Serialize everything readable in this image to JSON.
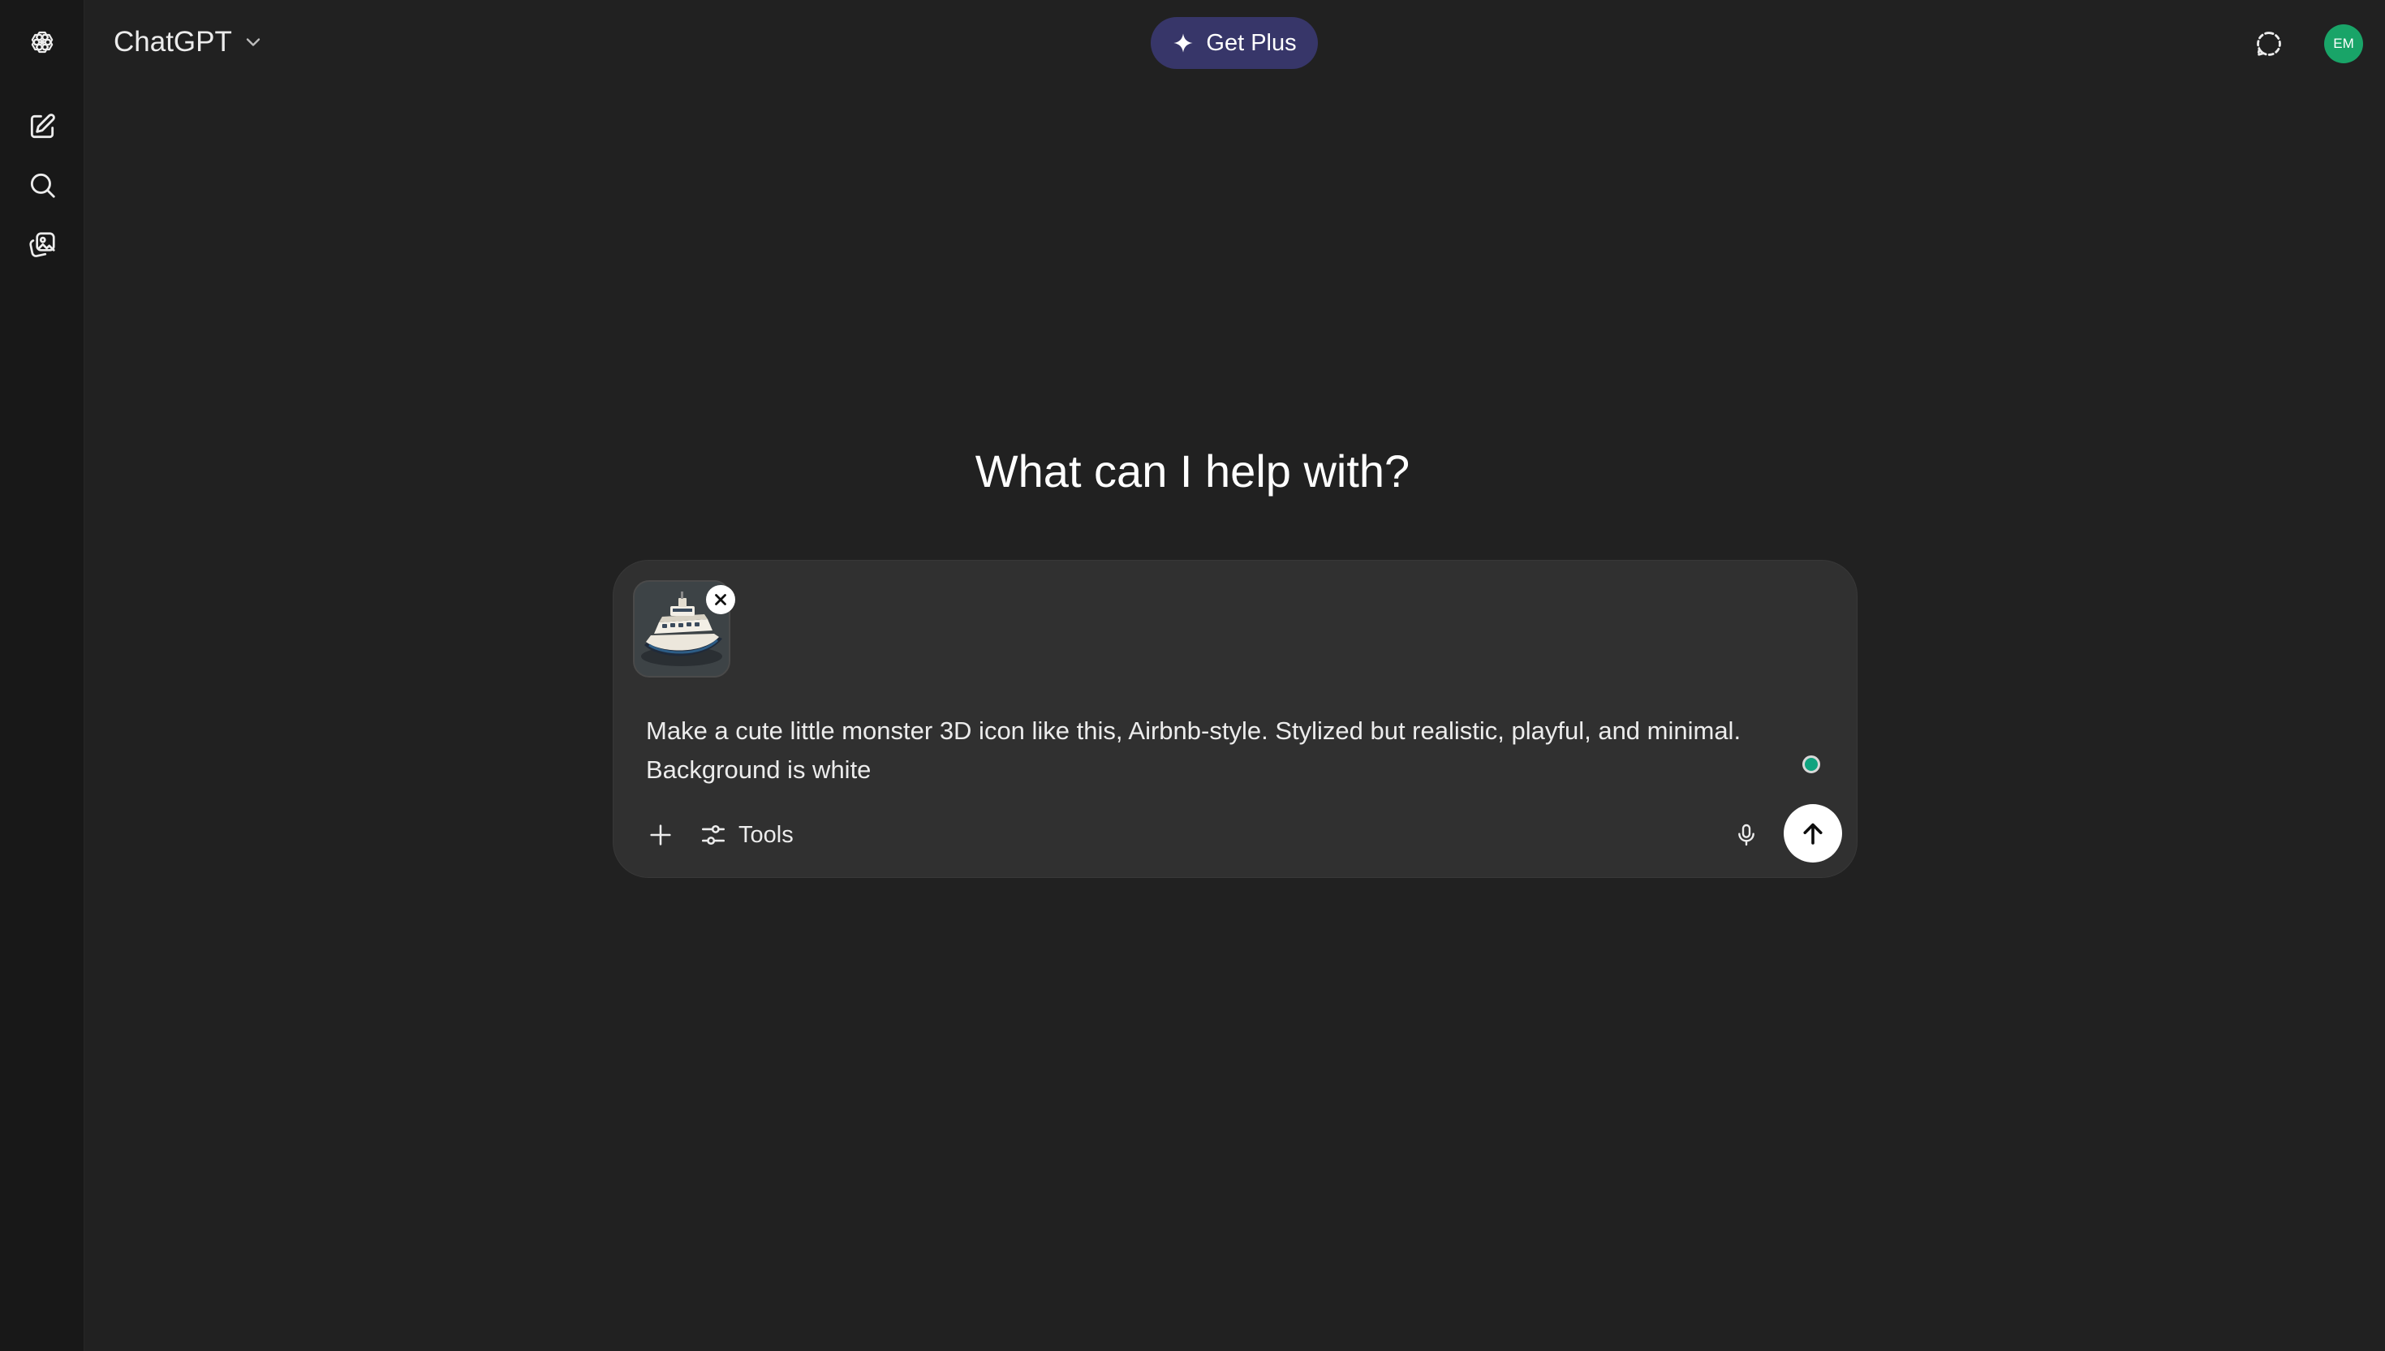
{
  "app": {
    "title": "ChatGPT"
  },
  "sidebar": {
    "items": [
      {
        "icon": "new-chat-icon"
      },
      {
        "icon": "search-icon"
      },
      {
        "icon": "library-icon"
      }
    ]
  },
  "header": {
    "upgrade_label": "Get Plus",
    "avatar_initials": "EM"
  },
  "main": {
    "headline": "What can I help with?"
  },
  "composer": {
    "attachment": {
      "icon": "ship-image"
    },
    "prompt_text": "Make a cute little monster 3D icon like this, Airbnb-style. Stylized but realistic, playful, and minimal.\nBackground is white",
    "tools_label": "Tools"
  },
  "colors": {
    "background": "#212121",
    "sidebar": "#181818",
    "composer": "#303030",
    "upgrade_pill": "#373669",
    "avatar": "#19a468",
    "status_dot": "#10a37f"
  }
}
